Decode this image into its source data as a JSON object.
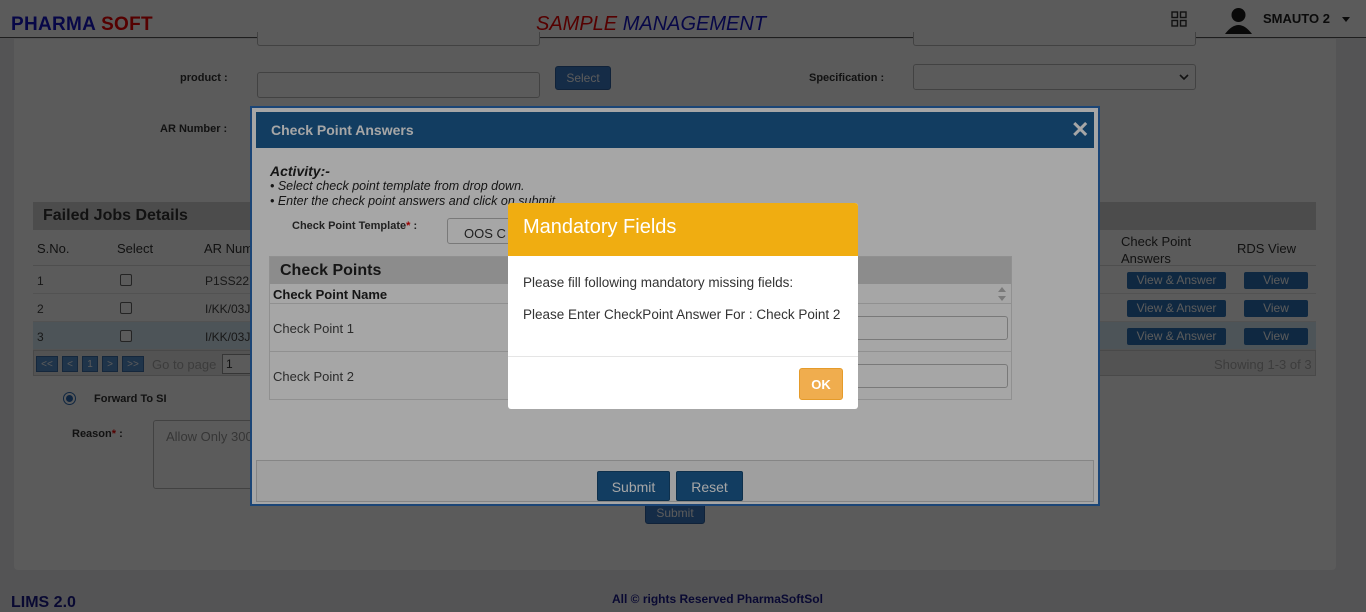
{
  "header": {
    "logo_a": "PHARMA",
    "logo_b": "SOFT",
    "title_a": "SAMPLE",
    "title_b": "MANAGEMENT",
    "username": "SMAUTO 2"
  },
  "form": {
    "product_label": "product :",
    "select_button": "Select",
    "specification_label": "Specification :",
    "ar_number_label": "AR Number :",
    "forward_label": "Forward To SI",
    "reason_label": "Reason",
    "reason_required": "*",
    "reason_colon": " :",
    "reason_placeholder": "Allow Only 300",
    "submit_button": "Submit"
  },
  "failed_jobs": {
    "title": "Failed Jobs Details",
    "columns": {
      "sno": "S.No.",
      "select": "Select",
      "ar_number": "AR Num",
      "check_point_answers": "Check Point Answers",
      "rds_view": "RDS View"
    },
    "rows": [
      {
        "sno": "1",
        "ar": "P1SS22",
        "answer_btn": "View & Answer",
        "rds_btn": "View"
      },
      {
        "sno": "2",
        "ar": "I/KK/03J",
        "answer_btn": "View & Answer",
        "rds_btn": "View"
      },
      {
        "sno": "3",
        "ar": "I/KK/03J",
        "answer_btn": "View & Answer",
        "rds_btn": "View"
      }
    ],
    "pager": {
      "first": "<<",
      "prev": "<",
      "page": "1",
      "next": ">",
      "last": ">>",
      "goto_label": "Go to page",
      "goto_value": "1",
      "showing": "Showing 1-3 of 3"
    }
  },
  "modal": {
    "title": "Check Point Answers",
    "activity_heading": "Activity:-",
    "activity_line1": "• Select check point template from drop down.",
    "activity_line2": "• Enter the check point answers and click on submit.",
    "template_label": "Check Point Template",
    "template_required": "*",
    "template_colon": " :",
    "template_value": "OOS C",
    "check_points_title": "Check Points",
    "col_name": "Check Point Name",
    "rows": [
      {
        "name": "Check Point 1"
      },
      {
        "name": "Check Point 2"
      }
    ],
    "submit": "Submit",
    "reset": "Reset"
  },
  "alert": {
    "title": "Mandatory Fields",
    "message1": "Please fill following mandatory missing fields:",
    "message2": "Please Enter CheckPoint Answer For : Check Point 2",
    "ok": "OK"
  },
  "footer": {
    "version": "LIMS 2.0",
    "copyright": "All © rights Reserved PharmaSoftSol"
  },
  "colors": {
    "brand_blue": "#1515c8",
    "brand_red": "#e00000",
    "modal_header": "#1d5f96",
    "alert_header": "#f0ad11",
    "ok_button": "#f0ad4e"
  }
}
